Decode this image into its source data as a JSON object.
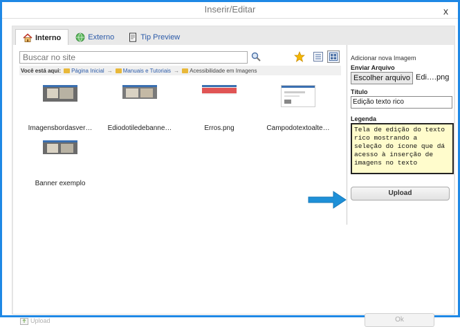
{
  "window": {
    "title": "Inserir/Editar",
    "close": "x"
  },
  "tabs": [
    {
      "label": "Interno",
      "icon": "house-icon",
      "active": true
    },
    {
      "label": "Externo",
      "icon": "globe-icon",
      "active": false
    },
    {
      "label": "Tip Preview",
      "icon": "document-icon",
      "active": false
    }
  ],
  "search": {
    "placeholder": "Buscar no site"
  },
  "breadcrumb": {
    "prefix": "Você está aqui:",
    "items": [
      "Página Inicial",
      "Manuais e Tutoriais",
      "Acessibilidade em Imagens"
    ],
    "separator": "→"
  },
  "files": [
    {
      "name": "Imagensbordasver…"
    },
    {
      "name": "Ediodotiledebanne…"
    },
    {
      "name": "Erros.png"
    },
    {
      "name": "Campodotextoalte…"
    },
    {
      "name": "Banner exemplo"
    }
  ],
  "upload_panel": {
    "heading": "Adicionar nova Imagem",
    "file_label": "Enviar Arquivo",
    "file_button": "Escolher arquivo",
    "file_name": "Edi….png",
    "title_label": "Título",
    "title_value": "Edição texto rico",
    "caption_label": "Legenda",
    "caption_value": "Tela de edição do texto\nrico mostrando a\nseleção do ícone que dá\nacesso à inserção de\nimagens no texto",
    "upload_button": "Upload"
  },
  "footer": {
    "upload_link": "Upload",
    "ok_button": "Ok"
  },
  "colors": {
    "frame": "#1e88e5",
    "caption_bg": "#fffccc",
    "arrow": "#1e90d8",
    "link": "#2b5aa8"
  }
}
